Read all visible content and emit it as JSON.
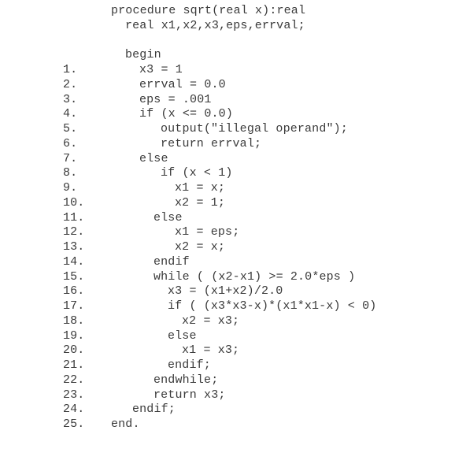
{
  "document": {
    "kind": "pseudocode-listing",
    "language": "pseudocode",
    "procedure_name": "sqrt",
    "background_color": "#ffffff",
    "text_color": "#3a3a3a"
  },
  "listing": {
    "lines": [
      {
        "number": "",
        "indent": 2,
        "code": "procedure sqrt(real x):real"
      },
      {
        "number": "",
        "indent": 4,
        "code": "real x1,x2,x3,eps,errval;"
      },
      {
        "number": "",
        "indent": 0,
        "code": ""
      },
      {
        "number": "",
        "indent": 4,
        "code": "begin"
      },
      {
        "number": "1.",
        "indent": 6,
        "code": "x3 = 1"
      },
      {
        "number": "2.",
        "indent": 6,
        "code": "errval = 0.0"
      },
      {
        "number": "3.",
        "indent": 6,
        "code": "eps = .001"
      },
      {
        "number": "4.",
        "indent": 6,
        "code": "if (x <= 0.0)"
      },
      {
        "number": "5.",
        "indent": 9,
        "code": "output(\"illegal operand\");"
      },
      {
        "number": "6.",
        "indent": 9,
        "code": "return errval;"
      },
      {
        "number": "7.",
        "indent": 6,
        "code": "else"
      },
      {
        "number": "8.",
        "indent": 9,
        "code": "if (x < 1)"
      },
      {
        "number": "9.",
        "indent": 11,
        "code": "x1 = x;"
      },
      {
        "number": "10.",
        "indent": 11,
        "code": "x2 = 1;"
      },
      {
        "number": "11.",
        "indent": 8,
        "code": "else"
      },
      {
        "number": "12.",
        "indent": 11,
        "code": "x1 = eps;"
      },
      {
        "number": "13.",
        "indent": 11,
        "code": "x2 = x;"
      },
      {
        "number": "14.",
        "indent": 8,
        "code": "endif"
      },
      {
        "number": "15.",
        "indent": 8,
        "code": "while ( (x2-x1) >= 2.0*eps )"
      },
      {
        "number": "16.",
        "indent": 10,
        "code": "x3 = (x1+x2)/2.0"
      },
      {
        "number": "17.",
        "indent": 10,
        "code": "if ( (x3*x3-x)*(x1*x1-x) < 0)"
      },
      {
        "number": "18.",
        "indent": 12,
        "code": "x2 = x3;"
      },
      {
        "number": "19.",
        "indent": 10,
        "code": "else"
      },
      {
        "number": "20.",
        "indent": 12,
        "code": "x1 = x3;"
      },
      {
        "number": "21.",
        "indent": 10,
        "code": "endif;"
      },
      {
        "number": "22.",
        "indent": 8,
        "code": "endwhile;"
      },
      {
        "number": "23.",
        "indent": 8,
        "code": "return x3;"
      },
      {
        "number": "24.",
        "indent": 5,
        "code": "endif;"
      },
      {
        "number": "25.",
        "indent": 2,
        "code": "end."
      }
    ]
  }
}
